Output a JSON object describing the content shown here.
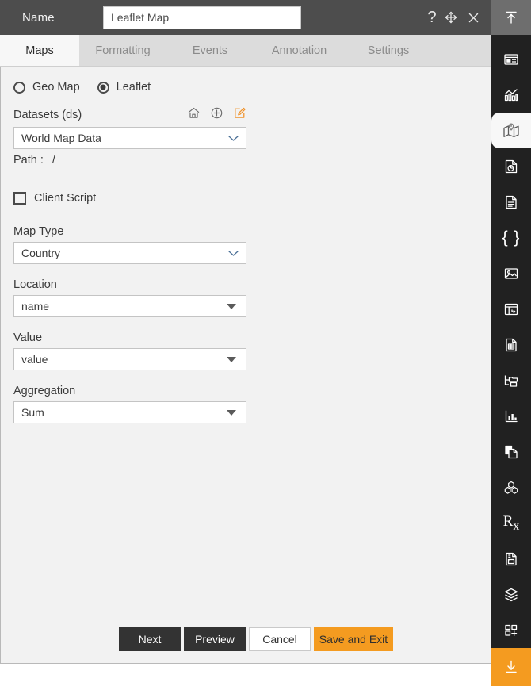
{
  "titlebar": {
    "name_label": "Name",
    "name_value": "Leaflet Map",
    "name_placeholder": "Name",
    "help_icon": "question-mark-icon",
    "move_icon": "move-arrows-icon",
    "close_icon": "close-icon",
    "help_glyph": "?",
    "close_glyph": "×"
  },
  "tabs": [
    {
      "label": "Maps",
      "name": "maps",
      "active": true
    },
    {
      "label": "Formatting",
      "name": "formatting",
      "active": false
    },
    {
      "label": "Events",
      "name": "events",
      "active": false
    },
    {
      "label": "Annotation",
      "name": "annotation",
      "active": false
    },
    {
      "label": "Settings",
      "name": "settings",
      "active": false
    }
  ],
  "form": {
    "map_engine": {
      "options": [
        {
          "label": "Geo Map",
          "selected": false
        },
        {
          "label": "Leaflet",
          "selected": true
        }
      ]
    },
    "datasets": {
      "label": "Datasets (ds)",
      "value": "World Map Data",
      "icons": [
        "home-icon",
        "add-circle-icon",
        "edit-square-icon"
      ]
    },
    "path": {
      "label": "Path :",
      "value": "/"
    },
    "client_script": {
      "label": "Client Script",
      "checked": false
    },
    "map_type": {
      "label": "Map Type",
      "value": "Country"
    },
    "location": {
      "label": "Location",
      "value": "name"
    },
    "value": {
      "label": "Value",
      "value": "value"
    },
    "aggregation": {
      "label": "Aggregation",
      "value": "Sum"
    }
  },
  "footer": {
    "buttons": [
      {
        "label": "Next",
        "style": "dark"
      },
      {
        "label": "Preview",
        "style": "dark"
      },
      {
        "label": "Cancel",
        "style": "light"
      },
      {
        "label": "Save and Exit",
        "style": "accent"
      }
    ]
  },
  "rail": {
    "collapse_icon": "collapse-up-icon",
    "items": [
      {
        "name": "dashboard-icon",
        "active": false
      },
      {
        "name": "chart-icon",
        "active": false
      },
      {
        "name": "map-icon",
        "active": true
      },
      {
        "name": "report-pie-icon",
        "active": false
      },
      {
        "name": "document-icon",
        "active": false
      },
      {
        "name": "json-braces-icon",
        "active": false
      },
      {
        "name": "image-icon",
        "active": false
      },
      {
        "name": "table-icon",
        "active": false
      },
      {
        "name": "file-list-icon",
        "active": false
      },
      {
        "name": "tree-folder-icon",
        "active": false
      },
      {
        "name": "bar-chart-axis-icon",
        "active": false
      },
      {
        "name": "copy-file-icon",
        "active": false
      },
      {
        "name": "cubes-icon",
        "active": false
      },
      {
        "name": "prescription-icon",
        "active": false
      },
      {
        "name": "save-document-icon",
        "active": false
      },
      {
        "name": "layers-icon",
        "active": false
      },
      {
        "name": "add-widget-icon",
        "active": false
      }
    ],
    "download_icon": "download-icon"
  },
  "colors": {
    "accent": "#f49b20",
    "titlebar": "#4d4d4d",
    "panel": "#f2f2f2",
    "rail": "#212121"
  }
}
